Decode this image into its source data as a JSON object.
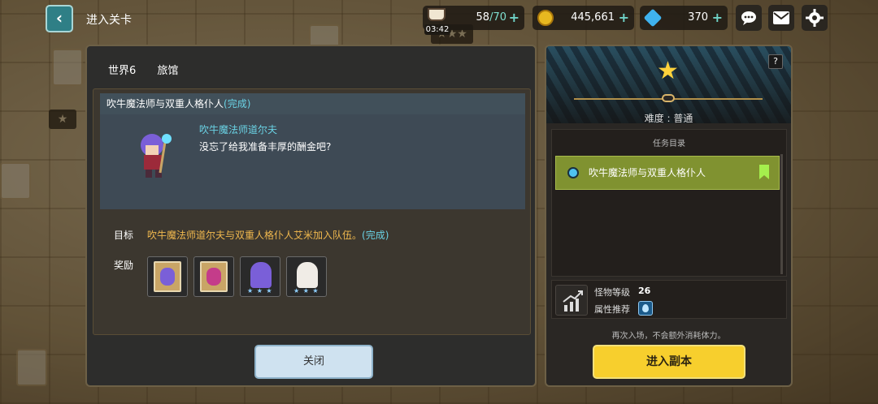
{
  "header": {
    "back_label": "‹",
    "title": "进入关卡"
  },
  "resources": {
    "stamina_current": "58",
    "stamina_max": "/70",
    "stamina_timer": "03:42",
    "gold": "445,661",
    "gems": "370",
    "plus": "+"
  },
  "crumbs": [
    "世界6",
    "旅馆"
  ],
  "quest": {
    "title": "吹牛魔法师与双重人格仆人",
    "status": "(完成)",
    "npc_name": "吹牛魔法师道尔夫",
    "npc_line": "没忘了给我准备丰厚的酬金吧?",
    "goal_label": "目标",
    "goal_text": "吹牛魔法师道尔夫与双重人格仆人艾米加入队伍。",
    "goal_status": "(完成)",
    "reward_label": "奖励",
    "reward_stars": "★ ★ ★"
  },
  "close_label": "关闭",
  "stage": {
    "help_label": "?",
    "star": "★",
    "difficulty_label": "难度 : 普通",
    "task_list_title": "任务目录",
    "task_item": "吹牛魔法师与双重人格仆人",
    "monster_level_label": "怪物等级",
    "monster_level": "26",
    "attribute_label": "属性推荐",
    "reentry_note": "再次入场，不会额外消耗体力。",
    "enter_label": "进入副本"
  },
  "map": {
    "star_label": "★★★",
    "star_single": "★"
  },
  "colors": {
    "accent_yellow": "#f7cf2d",
    "quest_done_blue": "#6ad2e4",
    "goal_orange": "#f0b84e",
    "task_green": "#809230"
  }
}
